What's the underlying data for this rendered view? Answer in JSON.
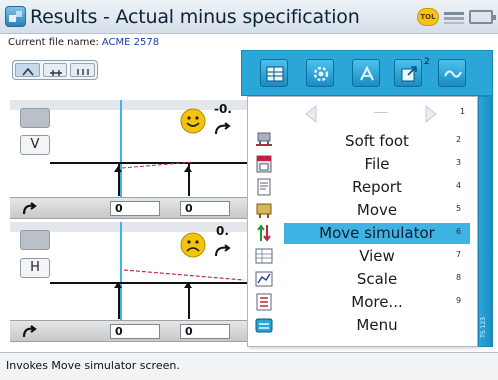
{
  "window": {
    "title": "Results - Actual minus specification",
    "status_badge": "TOL"
  },
  "file": {
    "label": "Current file name:",
    "name": "ACME 2578"
  },
  "plots": [
    {
      "orientation_label": "V",
      "readout": "-0.",
      "mood": "happy",
      "strip_values": [
        "0",
        "0"
      ]
    },
    {
      "orientation_label": "H",
      "readout": "0.",
      "mood": "sad",
      "strip_values": [
        "0",
        "0"
      ]
    }
  ],
  "context_menu": {
    "items": [
      {
        "label": "Soft foot",
        "shortcut": "2",
        "icon": "soft-foot-icon"
      },
      {
        "label": "File",
        "shortcut": "3",
        "icon": "file-icon"
      },
      {
        "label": "Report",
        "shortcut": "4",
        "icon": "report-icon"
      },
      {
        "label": "Move",
        "shortcut": "5",
        "icon": "move-icon"
      },
      {
        "label": "Move simulator",
        "shortcut": "6",
        "icon": "move-simulator-icon",
        "selected": true
      },
      {
        "label": "View",
        "shortcut": "7",
        "icon": "view-icon"
      },
      {
        "label": "Scale",
        "shortcut": "8",
        "icon": "scale-icon"
      },
      {
        "label": "More...",
        "shortcut": "9",
        "icon": "more-icon"
      },
      {
        "label": "Menu",
        "shortcut": "",
        "icon": "menu-icon"
      }
    ],
    "nav_page": "1"
  },
  "toolbar": {
    "superscript": "2"
  },
  "side_strip_text": "TS 123",
  "status": {
    "message": "Invokes Move simulator screen."
  },
  "colors": {
    "accent": "#2aa7d8",
    "selected_row": "#3fb3e3",
    "center_line": "#3bb6e6"
  }
}
